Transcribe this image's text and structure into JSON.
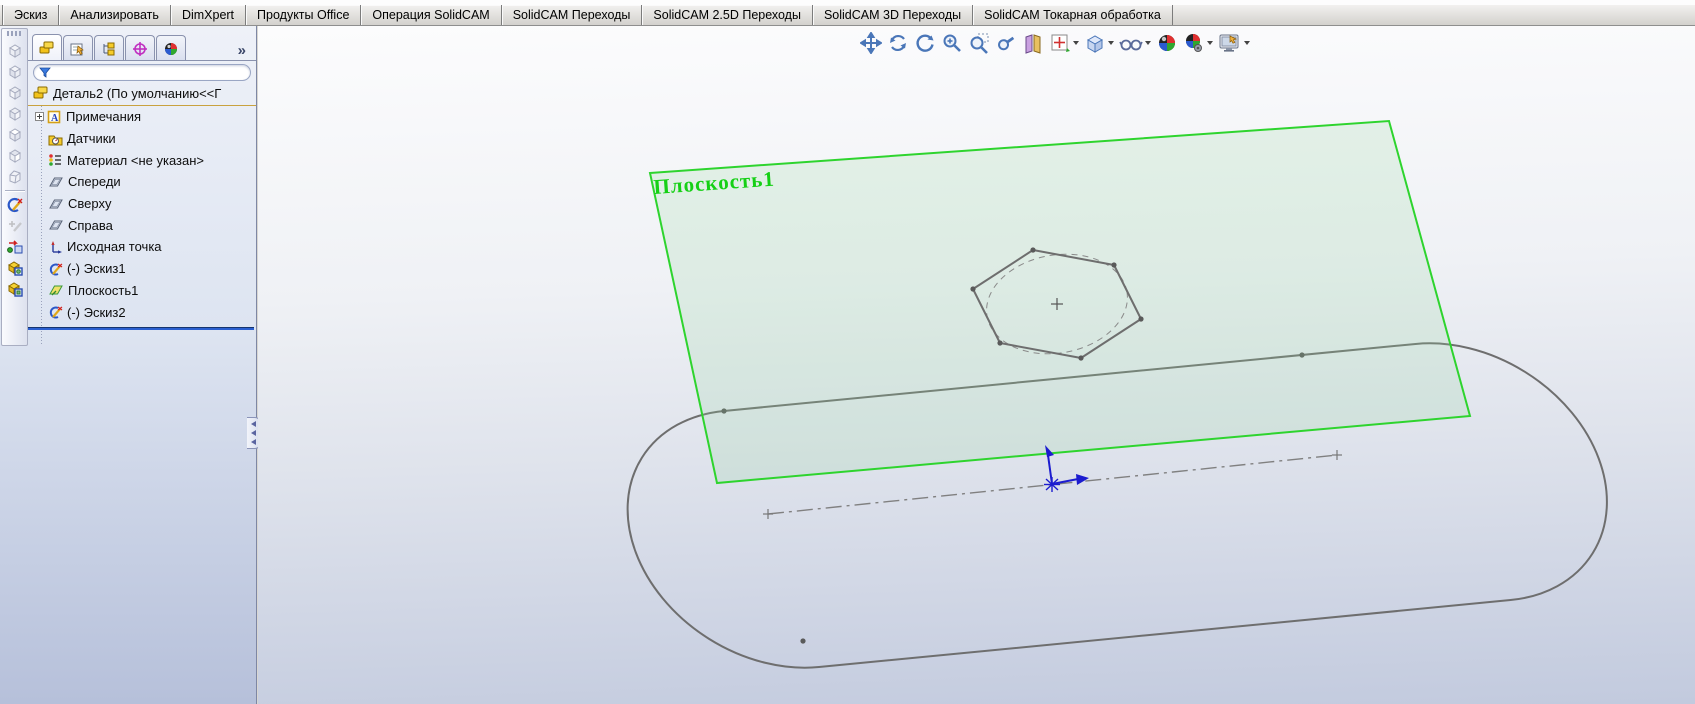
{
  "menubar": {
    "tabs": [
      {
        "label": "Эскиз"
      },
      {
        "label": "Анализировать"
      },
      {
        "label": "DimXpert"
      },
      {
        "label": "Продукты Office"
      },
      {
        "label": "Операция SolidCAM"
      },
      {
        "label": "SolidCAM Переходы"
      },
      {
        "label": "SolidCAM 2.5D Переходы"
      },
      {
        "label": "SolidCAM 3D Переходы"
      },
      {
        "label": "SolidCAM Токарная обработка"
      }
    ]
  },
  "left_toolbar": {
    "icons": [
      "view-cube-front",
      "view-cube-back",
      "view-cube-left",
      "view-cube-right",
      "view-cube-top",
      "view-cube-bottom",
      "view-cube-isometric",
      "sketch",
      "add-sketch-grayed",
      "move-entity",
      "solid-body-1",
      "solid-body-2"
    ]
  },
  "feature_panel": {
    "tabs": [
      "featuremanager-tree",
      "propertymanager",
      "configurationmanager",
      "dimxpertmanager",
      "displaymanager"
    ],
    "overflow_label": "»",
    "filter": {
      "value": "",
      "placeholder": ""
    },
    "tree": [
      {
        "label": "Деталь2  (По умолчанию<<Г",
        "icon": "part"
      },
      {
        "label": "Примечания",
        "icon": "annotations",
        "expandable": true
      },
      {
        "label": "Датчики",
        "icon": "sensors"
      },
      {
        "label": "Материал <не указан>",
        "icon": "material"
      },
      {
        "label": "Спереди",
        "icon": "reference-plane"
      },
      {
        "label": "Сверху",
        "icon": "reference-plane"
      },
      {
        "label": "Справа",
        "icon": "reference-plane"
      },
      {
        "label": "Исходная точка",
        "icon": "origin"
      },
      {
        "label": "(-) Эскиз1",
        "icon": "sketch"
      },
      {
        "label": "Плоскость1",
        "icon": "created-plane"
      },
      {
        "label": "(-) Эскиз2",
        "icon": "sketch"
      }
    ]
  },
  "viewport": {
    "hud_icons": [
      "pan",
      "rotate",
      "roll-view",
      "zoom-in-out",
      "zoom-to-area",
      "zoom-to-selection",
      "section-view",
      "view-orientation",
      "display-style",
      "hide-show-items",
      "apply-scene",
      "view-settings",
      "camera-preview"
    ],
    "plane_label": "Плоскость1",
    "colors": {
      "plane_border": "#2ed42e",
      "plane_fill": "rgba(150,215,160,0.20)",
      "plane_label_text": "#15d015",
      "sketch_line": "#6e6e6e",
      "construction_line": "#808080",
      "origin_arrows": "#1c1ccf",
      "rollback_bar": "#2a5fd0"
    }
  }
}
